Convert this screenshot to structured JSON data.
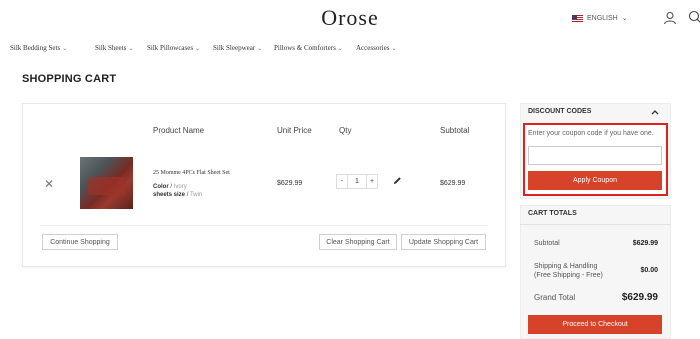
{
  "header": {
    "logo": "Orose",
    "language": "ENGLISH"
  },
  "nav": [
    {
      "label": "Silk Bedding Sets"
    },
    {
      "label": "Silk Sheets"
    },
    {
      "label": "Silk Pillowcases"
    },
    {
      "label": "Silk Sleepwear"
    },
    {
      "label": "Pillows & Comforters"
    },
    {
      "label": "Accessories"
    }
  ],
  "page_title": "SHOPPING CART",
  "cart": {
    "headers": {
      "product": "Product Name",
      "unit_price": "Unit Price",
      "qty": "Qty",
      "subtotal": "Subtotal"
    },
    "item": {
      "name": "25 Momme 4PCs Flat Sheet Set",
      "color_label": "Color",
      "color_value": "Ivory",
      "size_label": "sheets size",
      "size_value": "Twin",
      "unit_price": "$629.99",
      "qty": "1",
      "minus": "-",
      "plus": "+",
      "subtotal": "$629.99"
    },
    "buttons": {
      "continue": "Continue Shopping",
      "clear": "Clear Shopping Cart",
      "update": "Update Shopping Cart"
    }
  },
  "discount": {
    "title": "DISCOUNT CODES",
    "note": "Enter your coupon code if you have one.",
    "apply": "Apply Coupon"
  },
  "totals": {
    "title": "CART TOTALS",
    "subtotal_label": "Subtotal",
    "subtotal_value": "$629.99",
    "shipping_label": "Shipping & Handling (Free Shipping - Free)",
    "shipping_value": "$0.00",
    "grand_label": "Grand Total",
    "grand_value": "$629.99",
    "checkout": "Proceed to Checkout"
  },
  "colors": {
    "accent": "#d7432a",
    "highlight_border": "#e01f1f"
  }
}
